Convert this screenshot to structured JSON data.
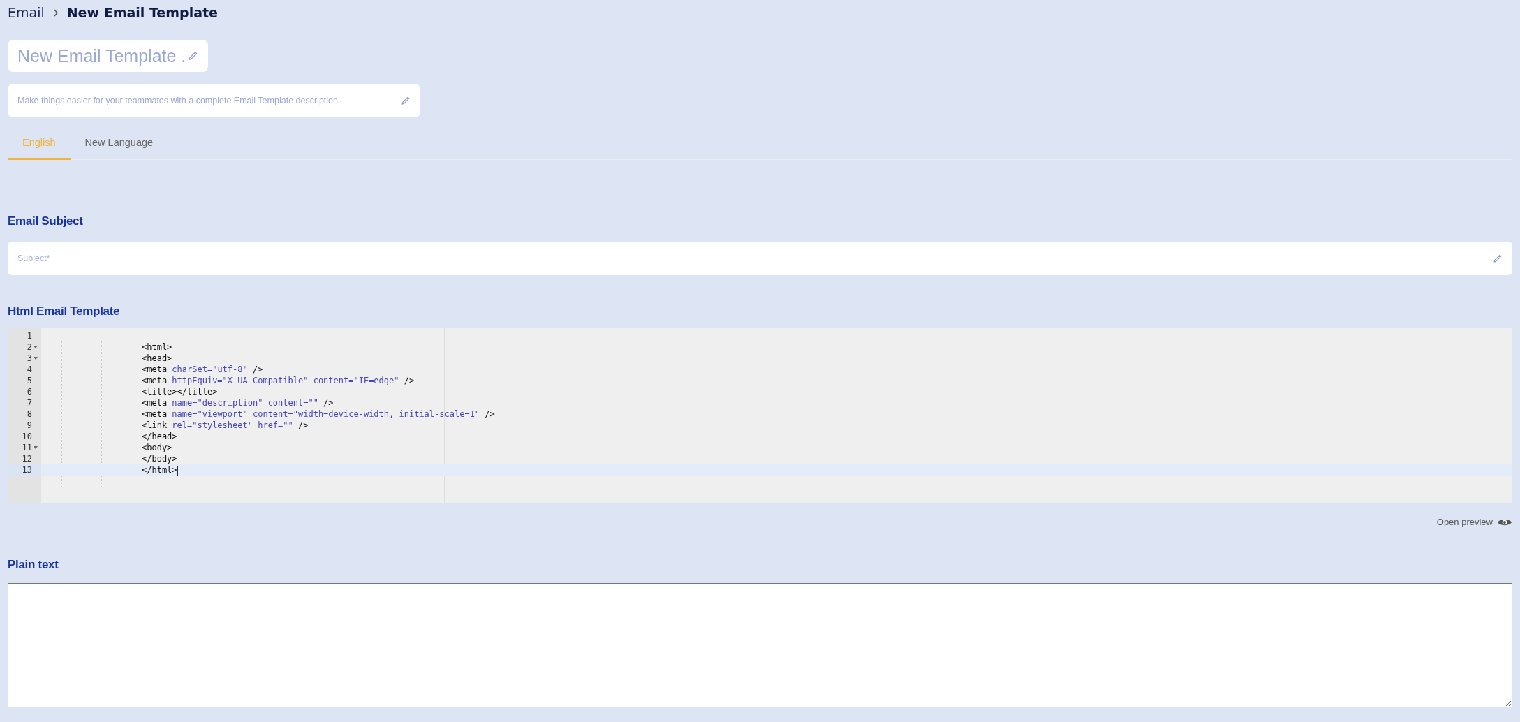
{
  "breadcrumb": {
    "parent": "Email",
    "current": "New Email Template"
  },
  "title_field": {
    "placeholder": "New Email Template ."
  },
  "description_field": {
    "placeholder": "Make things easier for your teammates with a complete Email Template description."
  },
  "tabs": [
    {
      "label": "English",
      "selected": true
    },
    {
      "label": "New Language",
      "selected": false
    }
  ],
  "subject_section": {
    "heading": "Email Subject",
    "placeholder": "Subject*"
  },
  "html_section": {
    "heading": "Html Email Template",
    "lines": [
      {
        "number": "1",
        "foldable": false,
        "active": false
      },
      {
        "number": "2",
        "foldable": true,
        "active": false,
        "tokens": [
          {
            "kind": "tag",
            "text": "<html>"
          }
        ]
      },
      {
        "number": "3",
        "foldable": true,
        "active": false,
        "tokens": [
          {
            "kind": "tag",
            "text": "<head>"
          }
        ]
      },
      {
        "number": "4",
        "foldable": false,
        "active": false,
        "tokens": [
          {
            "kind": "tag",
            "text": "<meta"
          },
          {
            "kind": "attr",
            "text": " charSet="
          },
          {
            "kind": "string",
            "text": "\"utf-8\""
          },
          {
            "kind": "tag",
            "text": " />"
          }
        ]
      },
      {
        "number": "5",
        "foldable": false,
        "active": false,
        "tokens": [
          {
            "kind": "tag",
            "text": "<meta"
          },
          {
            "kind": "attr",
            "text": " httpEquiv="
          },
          {
            "kind": "string",
            "text": "\"X-UA-Compatible\""
          },
          {
            "kind": "attr",
            "text": " content="
          },
          {
            "kind": "string",
            "text": "\"IE=edge\""
          },
          {
            "kind": "tag",
            "text": " />"
          }
        ]
      },
      {
        "number": "6",
        "foldable": false,
        "active": false,
        "tokens": [
          {
            "kind": "tag",
            "text": "<title></title>"
          }
        ]
      },
      {
        "number": "7",
        "foldable": false,
        "active": false,
        "tokens": [
          {
            "kind": "tag",
            "text": "<meta"
          },
          {
            "kind": "attr",
            "text": " name="
          },
          {
            "kind": "string",
            "text": "\"description\""
          },
          {
            "kind": "attr",
            "text": " content="
          },
          {
            "kind": "string",
            "text": "\"\""
          },
          {
            "kind": "tag",
            "text": " />"
          }
        ]
      },
      {
        "number": "8",
        "foldable": false,
        "active": false,
        "tokens": [
          {
            "kind": "tag",
            "text": "<meta"
          },
          {
            "kind": "attr",
            "text": " name="
          },
          {
            "kind": "string",
            "text": "\"viewport\""
          },
          {
            "kind": "attr",
            "text": " content="
          },
          {
            "kind": "string",
            "text": "\"width=device-width, initial-scale=1\""
          },
          {
            "kind": "tag",
            "text": " />"
          }
        ]
      },
      {
        "number": "9",
        "foldable": false,
        "active": false,
        "tokens": [
          {
            "kind": "tag",
            "text": "<link"
          },
          {
            "kind": "attr",
            "text": " rel="
          },
          {
            "kind": "string",
            "text": "\"stylesheet\""
          },
          {
            "kind": "attr",
            "text": " href="
          },
          {
            "kind": "string",
            "text": "\"\""
          },
          {
            "kind": "tag",
            "text": " />"
          }
        ]
      },
      {
        "number": "10",
        "foldable": false,
        "active": false,
        "tokens": [
          {
            "kind": "tag",
            "text": "</head>"
          }
        ]
      },
      {
        "number": "11",
        "foldable": true,
        "active": false,
        "tokens": [
          {
            "kind": "tag",
            "text": "<body>"
          }
        ]
      },
      {
        "number": "12",
        "foldable": false,
        "active": false,
        "tokens": [
          {
            "kind": "tag",
            "text": "</body>"
          }
        ]
      },
      {
        "number": "13",
        "foldable": false,
        "active": true,
        "tokens": [
          {
            "kind": "tag",
            "text": "</html>"
          }
        ]
      }
    ]
  },
  "preview_link": {
    "label": "Open preview"
  },
  "plain_text_section": {
    "heading": "Plain text"
  }
}
